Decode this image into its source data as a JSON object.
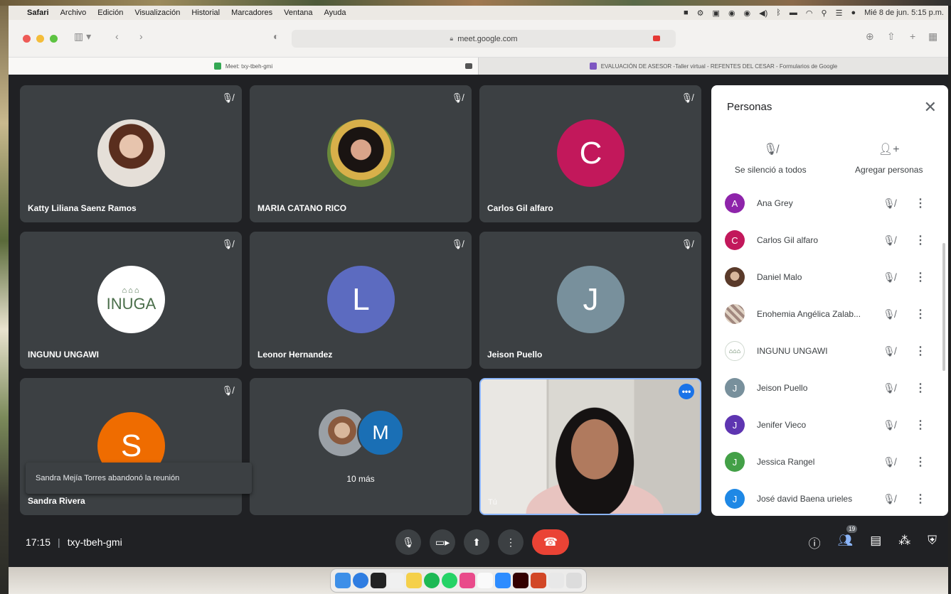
{
  "menubar": {
    "app_name": "Safari",
    "items": [
      "Archivo",
      "Edición",
      "Visualización",
      "Historial",
      "Marcadores",
      "Ventana",
      "Ayuda"
    ],
    "clock": "Mié 8 de jun. 5:15 p.m."
  },
  "browser": {
    "url": "meet.google.com",
    "tabs": [
      {
        "label": "Meet: txy-tbeh-gmi",
        "favicon_color": "#34a853"
      },
      {
        "label": "EVALUACIÓN DE ASESOR -Taller virtual - REFENTES DEL CESAR - Formularios de Google",
        "favicon_color": "#7e57c2"
      }
    ]
  },
  "tiles": [
    {
      "name": "Katty Liliana Saenz Ramos",
      "avatar": "photo"
    },
    {
      "name": "MARIA CATANO RICO",
      "avatar": "photo"
    },
    {
      "name": "Carlos Gil alfaro",
      "letter": "C",
      "color": "#c2185b"
    },
    {
      "name": "INGUNU UNGAWI",
      "avatar": "logo",
      "logo_text": "INUGA"
    },
    {
      "name": "Leonor Hernandez",
      "letter": "L",
      "color": "#5c6bc0"
    },
    {
      "name": "Jeison Puello",
      "letter": "J",
      "color": "#78909c"
    },
    {
      "name": "Sandra Rivera",
      "letter": "S",
      "color": "#ef6c00"
    },
    {
      "more_label": "10 más",
      "letter": "M",
      "color": "#1a6fb5"
    },
    {
      "self_label": "Tú"
    }
  ],
  "toast": "Sandra Mejía Torres abandonó la reunión",
  "people_panel": {
    "title": "Personas",
    "mute_all_label": "Se silenció a todos",
    "add_people_label": "Agregar personas",
    "participants": [
      {
        "name": "Ana Grey",
        "initial": "A",
        "color": "#8e24aa"
      },
      {
        "name": "Carlos Gil alfaro",
        "initial": "C",
        "color": "#c2185b"
      },
      {
        "name": "Daniel Malo",
        "initial": "",
        "color": "#8d6e63"
      },
      {
        "name": "Enohemia Angélica Zalab...",
        "initial": "",
        "color": "#a1887f"
      },
      {
        "name": "INGUNU UNGAWI",
        "initial": "",
        "color": "#cfd8cf"
      },
      {
        "name": "Jeison Puello",
        "initial": "J",
        "color": "#78909c"
      },
      {
        "name": "Jenifer Vieco",
        "initial": "J",
        "color": "#5e35b1"
      },
      {
        "name": "Jessica Rangel",
        "initial": "J",
        "color": "#43a047"
      },
      {
        "name": "José david Baena urieles",
        "initial": "J",
        "color": "#1e88e5"
      }
    ]
  },
  "bottom": {
    "time": "17:15",
    "separator": "|",
    "meeting_code": "txy-tbeh-gmi",
    "people_count": "19"
  }
}
